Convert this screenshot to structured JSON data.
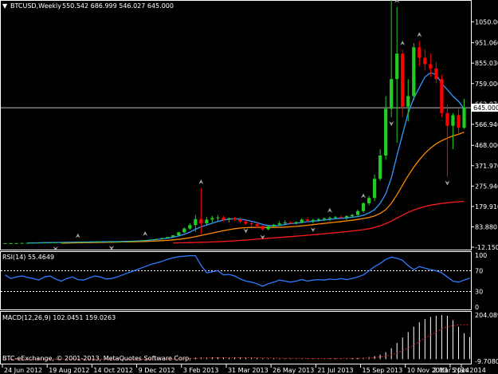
{
  "window": {
    "title_prefix": "BTCUSD,Weekly",
    "ohlc_text": "550.542 686.999 546.027 645.000",
    "copyright": "BTC-eExchange, © 2001-2013, MetaQuotes Software Corp."
  },
  "colors": {
    "background": "#000000",
    "grid": "#ffffff",
    "bull": "#22cc22",
    "bear": "#ff0000",
    "ma_fast": "#3399ff",
    "ma_mid": "#ff8800",
    "ma_slow": "#ff1a1a",
    "rsi": "#2f7cff",
    "macd_signal": "#cc2222",
    "macd_hist": "#ffffff"
  },
  "panels": {
    "rsi_label": "RSI(14) 55.4649",
    "macd_label": "MACD(12,26,9) 102.0451 159.0263"
  },
  "axes": {
    "price_ticks": [
      "1050.000",
      "951.060",
      "855.030",
      "759.000",
      "662.070",
      "566.940",
      "468.000",
      "371.970",
      "275.940",
      "179.910",
      "83.880",
      "-12.150"
    ],
    "current_price_label": "645.000",
    "rsi_ticks": [
      "100",
      "70",
      "30",
      "0"
    ],
    "macd_ticks": [
      "204.0893",
      "-9.7080"
    ],
    "date_ticks": [
      "24 Jun 2012",
      "19 Aug 2012",
      "14 Oct 2012",
      "9 Dec 2012",
      "3 Feb 2013",
      "31 Mar 2013",
      "26 May 2013",
      "21 Jul 2013",
      "15 Sep 2013",
      "10 Nov 2013",
      "5 Jan 2014",
      "2 Mar 2014"
    ]
  },
  "chart_data": {
    "type": "candlestick",
    "title": "BTCUSD,Weekly",
    "ylim": [
      -12.15,
      1100
    ],
    "candles": [
      {
        "o": 6.5,
        "h": 7,
        "l": 6,
        "c": 6.8
      },
      {
        "o": 6.8,
        "h": 7.2,
        "l": 6.5,
        "c": 7
      },
      {
        "o": 7,
        "h": 7.5,
        "l": 6.8,
        "c": 7.3
      },
      {
        "o": 7.3,
        "h": 8,
        "l": 7,
        "c": 7.8
      },
      {
        "o": 7.8,
        "h": 8.5,
        "l": 7.5,
        "c": 8.3
      },
      {
        "o": 8.3,
        "h": 9,
        "l": 8,
        "c": 8.8
      },
      {
        "o": 8.8,
        "h": 9.5,
        "l": 8.5,
        "c": 9.2
      },
      {
        "o": 9.2,
        "h": 10,
        "l": 9,
        "c": 9.8
      },
      {
        "o": 9.8,
        "h": 10.5,
        "l": 9.5,
        "c": 10.2
      },
      {
        "o": 10.2,
        "h": 10.8,
        "l": 9.8,
        "c": 10.5
      },
      {
        "o": 10.5,
        "h": 11,
        "l": 10,
        "c": 10.8
      },
      {
        "o": 10.8,
        "h": 11.5,
        "l": 10.5,
        "c": 11.2
      },
      {
        "o": 11.2,
        "h": 12,
        "l": 11,
        "c": 11.8
      },
      {
        "o": 11.8,
        "h": 12.5,
        "l": 11.5,
        "c": 12.2
      },
      {
        "o": 12.2,
        "h": 13,
        "l": 12,
        "c": 12.8
      },
      {
        "o": 12.8,
        "h": 13.5,
        "l": 12.5,
        "c": 13.2
      },
      {
        "o": 13.2,
        "h": 13.8,
        "l": 12.8,
        "c": 13.5
      },
      {
        "o": 13.5,
        "h": 14,
        "l": 13,
        "c": 13.7
      },
      {
        "o": 13.7,
        "h": 14.2,
        "l": 13.3,
        "c": 13.9
      },
      {
        "o": 13.9,
        "h": 14.5,
        "l": 13.5,
        "c": 14.2
      },
      {
        "o": 14.2,
        "h": 15,
        "l": 14,
        "c": 14.8
      },
      {
        "o": 14.8,
        "h": 16,
        "l": 14.5,
        "c": 15.6
      },
      {
        "o": 15.6,
        "h": 17,
        "l": 15.2,
        "c": 16.5
      },
      {
        "o": 16.5,
        "h": 18,
        "l": 16,
        "c": 17.5
      },
      {
        "o": 17.5,
        "h": 20,
        "l": 17,
        "c": 19.5
      },
      {
        "o": 19.5,
        "h": 22,
        "l": 19,
        "c": 21.5
      },
      {
        "o": 21.5,
        "h": 25,
        "l": 21,
        "c": 24
      },
      {
        "o": 24,
        "h": 28,
        "l": 23,
        "c": 27
      },
      {
        "o": 27,
        "h": 32,
        "l": 26,
        "c": 31
      },
      {
        "o": 31,
        "h": 37,
        "l": 30,
        "c": 36
      },
      {
        "o": 36,
        "h": 45,
        "l": 35,
        "c": 44
      },
      {
        "o": 44,
        "h": 60,
        "l": 42,
        "c": 58
      },
      {
        "o": 58,
        "h": 80,
        "l": 55,
        "c": 76
      },
      {
        "o": 76,
        "h": 100,
        "l": 70,
        "c": 92
      },
      {
        "o": 92,
        "h": 140,
        "l": 60,
        "c": 120
      },
      {
        "o": 120,
        "h": 266,
        "l": 50,
        "c": 100
      },
      {
        "o": 100,
        "h": 130,
        "l": 90,
        "c": 118
      },
      {
        "o": 118,
        "h": 135,
        "l": 105,
        "c": 125
      },
      {
        "o": 125,
        "h": 140,
        "l": 110,
        "c": 128
      },
      {
        "o": 128,
        "h": 135,
        "l": 110,
        "c": 118
      },
      {
        "o": 118,
        "h": 128,
        "l": 105,
        "c": 124
      },
      {
        "o": 124,
        "h": 132,
        "l": 112,
        "c": 120
      },
      {
        "o": 120,
        "h": 128,
        "l": 100,
        "c": 108
      },
      {
        "o": 108,
        "h": 115,
        "l": 95,
        "c": 100
      },
      {
        "o": 100,
        "h": 110,
        "l": 85,
        "c": 96
      },
      {
        "o": 96,
        "h": 104,
        "l": 80,
        "c": 88
      },
      {
        "o": 88,
        "h": 100,
        "l": 65,
        "c": 72
      },
      {
        "o": 72,
        "h": 90,
        "l": 68,
        "c": 86
      },
      {
        "o": 86,
        "h": 98,
        "l": 80,
        "c": 94
      },
      {
        "o": 94,
        "h": 110,
        "l": 88,
        "c": 100
      },
      {
        "o": 100,
        "h": 115,
        "l": 92,
        "c": 104
      },
      {
        "o": 104,
        "h": 112,
        "l": 96,
        "c": 100
      },
      {
        "o": 100,
        "h": 110,
        "l": 95,
        "c": 106
      },
      {
        "o": 106,
        "h": 125,
        "l": 100,
        "c": 118
      },
      {
        "o": 118,
        "h": 130,
        "l": 105,
        "c": 112
      },
      {
        "o": 112,
        "h": 122,
        "l": 100,
        "c": 116
      },
      {
        "o": 116,
        "h": 126,
        "l": 108,
        "c": 120
      },
      {
        "o": 120,
        "h": 128,
        "l": 112,
        "c": 124
      },
      {
        "o": 124,
        "h": 132,
        "l": 110,
        "c": 126
      },
      {
        "o": 126,
        "h": 135,
        "l": 120,
        "c": 130
      },
      {
        "o": 130,
        "h": 138,
        "l": 122,
        "c": 128
      },
      {
        "o": 128,
        "h": 138,
        "l": 115,
        "c": 134
      },
      {
        "o": 134,
        "h": 145,
        "l": 128,
        "c": 140
      },
      {
        "o": 140,
        "h": 165,
        "l": 135,
        "c": 158
      },
      {
        "o": 158,
        "h": 200,
        "l": 150,
        "c": 195
      },
      {
        "o": 195,
        "h": 230,
        "l": 185,
        "c": 220
      },
      {
        "o": 220,
        "h": 330,
        "l": 205,
        "c": 310
      },
      {
        "o": 310,
        "h": 450,
        "l": 300,
        "c": 420
      },
      {
        "o": 420,
        "h": 700,
        "l": 400,
        "c": 640
      },
      {
        "o": 640,
        "h": 1165,
        "l": 600,
        "c": 780
      },
      {
        "o": 780,
        "h": 1120,
        "l": 480,
        "c": 900
      },
      {
        "o": 900,
        "h": 920,
        "l": 600,
        "c": 650
      },
      {
        "o": 650,
        "h": 780,
        "l": 580,
        "c": 700
      },
      {
        "o": 700,
        "h": 950,
        "l": 680,
        "c": 930
      },
      {
        "o": 930,
        "h": 960,
        "l": 840,
        "c": 880
      },
      {
        "o": 880,
        "h": 920,
        "l": 820,
        "c": 850
      },
      {
        "o": 850,
        "h": 900,
        "l": 790,
        "c": 830
      },
      {
        "o": 830,
        "h": 860,
        "l": 760,
        "c": 780
      },
      {
        "o": 780,
        "h": 800,
        "l": 600,
        "c": 620
      },
      {
        "o": 620,
        "h": 660,
        "l": 320,
        "c": 560
      },
      {
        "o": 560,
        "h": 620,
        "l": 450,
        "c": 610
      },
      {
        "o": 610,
        "h": 640,
        "l": 520,
        "c": 550
      },
      {
        "o": 550.542,
        "h": 686.999,
        "l": 546.027,
        "c": 645
      }
    ],
    "ma_fast": [
      null,
      null,
      null,
      null,
      7.6,
      8.1,
      8.6,
      9.1,
      9.6,
      10.1,
      10.5,
      10.9,
      11.3,
      11.8,
      12.2,
      12.7,
      13.1,
      13.4,
      13.7,
      14,
      14.3,
      14.8,
      15.5,
      16.4,
      17.6,
      19.2,
      21.2,
      23.8,
      26.8,
      30.4,
      35,
      41,
      49,
      59,
      72,
      84,
      92,
      101,
      109,
      116,
      120,
      122,
      120,
      116,
      110,
      104,
      95,
      90,
      88,
      90,
      95,
      99,
      101,
      104,
      108,
      110,
      113,
      116,
      119,
      122,
      124,
      126,
      129,
      132,
      138,
      149,
      165,
      195,
      240,
      315,
      420,
      520,
      620,
      690,
      740,
      790,
      810,
      800,
      760,
      730,
      700,
      675,
      640
    ],
    "ma_mid": [
      null,
      null,
      null,
      null,
      null,
      null,
      null,
      null,
      null,
      null,
      7,
      7.5,
      8,
      8.5,
      9,
      9.5,
      10,
      10.5,
      11,
      11.5,
      12,
      12.5,
      13,
      13.5,
      14.2,
      15,
      16,
      17.2,
      18.6,
      20.3,
      22.4,
      25,
      28.3,
      32.5,
      37.8,
      43.6,
      49,
      54.5,
      60,
      65.5,
      70.5,
      75,
      78,
      80,
      81,
      81.5,
      81.5,
      81,
      81,
      81.5,
      82.5,
      84,
      86,
      88.5,
      91,
      94,
      97,
      100,
      103,
      106,
      109,
      112,
      115,
      118.5,
      123,
      128,
      135,
      147,
      165,
      195,
      235,
      280,
      325,
      365,
      400,
      430,
      455,
      475,
      490,
      502,
      512,
      520,
      530
    ],
    "ma_slow": [
      null,
      null,
      null,
      null,
      null,
      null,
      null,
      null,
      null,
      null,
      null,
      null,
      null,
      null,
      null,
      null,
      null,
      null,
      null,
      null,
      null,
      null,
      null,
      null,
      null,
      null,
      null,
      null,
      null,
      null,
      8,
      8.5,
      9,
      9.6,
      10.3,
      11,
      11.8,
      12.7,
      13.8,
      15,
      16.4,
      18,
      19.8,
      21.7,
      23.7,
      25.8,
      27.8,
      29.8,
      31.8,
      33.8,
      35.8,
      37.8,
      39.9,
      42,
      44.3,
      46.6,
      49,
      51.4,
      53.8,
      56.3,
      58.8,
      61.3,
      64,
      67,
      70.5,
      75,
      81,
      89,
      99,
      111,
      125,
      139,
      152,
      163,
      172,
      180,
      186,
      190,
      194,
      197,
      200,
      202,
      204
    ],
    "rsi": [
      62,
      55,
      58,
      60,
      57,
      55,
      52,
      58,
      60,
      54,
      50,
      55,
      58,
      53,
      52,
      56,
      60,
      58,
      54,
      55,
      58,
      62,
      66,
      70,
      74,
      78,
      82,
      85,
      88,
      92,
      95,
      97,
      98,
      99,
      99,
      80,
      66,
      68,
      70,
      62,
      63,
      60,
      54,
      50,
      48,
      45,
      40,
      45,
      48,
      52,
      50,
      48,
      50,
      53,
      50,
      52,
      53,
      52,
      54,
      53,
      55,
      53,
      55,
      58,
      62,
      70,
      78,
      84,
      92,
      96,
      94,
      90,
      80,
      72,
      78,
      75,
      72,
      70,
      66,
      58,
      50,
      48,
      52,
      55.4649
    ],
    "macd_main": [
      0,
      0,
      0,
      0,
      0,
      0,
      0,
      0,
      0,
      0,
      0,
      0,
      0,
      0,
      0,
      0,
      0,
      0,
      0,
      0,
      0,
      0,
      0,
      0,
      0,
      0.2,
      0.4,
      0.7,
      1,
      1.5,
      2,
      3,
      4,
      5.5,
      7,
      8,
      8.5,
      8.6,
      8.7,
      8.6,
      8.3,
      8,
      7.5,
      6.8,
      6,
      5,
      4,
      3.4,
      3,
      2.8,
      2.7,
      2.6,
      2.5,
      2.4,
      2.5,
      2.6,
      2.7,
      2.9,
      3.1,
      3.3,
      3.6,
      4,
      4.6,
      5.5,
      7,
      10,
      14,
      21,
      32,
      50,
      75,
      100,
      125,
      150,
      170,
      185,
      195,
      200,
      204,
      200,
      180,
      150,
      120,
      102.0451
    ],
    "macd_signal": [
      0,
      0,
      0,
      0,
      0,
      0,
      0,
      0,
      0,
      0,
      0,
      0,
      0,
      0,
      0,
      0,
      0,
      0,
      0,
      0,
      0,
      0,
      0,
      0,
      0,
      0,
      0.1,
      0.2,
      0.3,
      0.5,
      0.8,
      1.2,
      1.8,
      2.6,
      3.5,
      4.5,
      5.3,
      6,
      6.5,
      6.9,
      7.2,
      7.3,
      7.3,
      7.2,
      6.9,
      6.5,
      6,
      5.4,
      4.9,
      4.5,
      4.2,
      3.9,
      3.7,
      3.5,
      3.4,
      3.3,
      3.2,
      3.2,
      3.3,
      3.3,
      3.4,
      3.5,
      3.7,
      4,
      4.6,
      5.6,
      7.2,
      9.8,
      14,
      20,
      28,
      39,
      52,
      66,
      81,
      96,
      111,
      125,
      140,
      150,
      155,
      158,
      159,
      159.0263
    ]
  }
}
